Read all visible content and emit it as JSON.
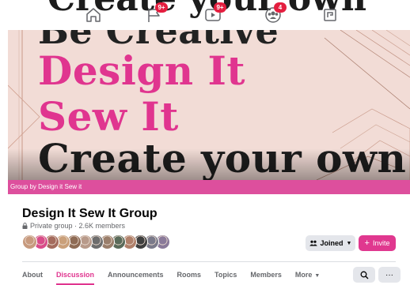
{
  "topnav": {
    "icons": [
      {
        "name": "home-icon",
        "badge": ""
      },
      {
        "name": "flag-icon",
        "badge": "9+"
      },
      {
        "name": "video-icon",
        "badge": "9+"
      },
      {
        "name": "groups-icon",
        "badge": "4"
      },
      {
        "name": "gaming-icon",
        "badge": ""
      }
    ]
  },
  "cover": {
    "lines": [
      "Be Creative",
      "Design It",
      "Sew It",
      "Create your own"
    ],
    "accent_color": "#e0358f",
    "background_color": "#f2dcd6",
    "strip_label": "Group by Design it Sew it",
    "strip_color": "#dd4f9d"
  },
  "group": {
    "name": "Design It Sew It Group",
    "meta": "Private group · 2.6K members",
    "avatar_colors": [
      "#c79a7e",
      "#d94c8a",
      "#a46b5d",
      "#caa07a",
      "#8e6b55",
      "#b89a8a",
      "#6d6d6d",
      "#9a7e6b",
      "#5a6b5a",
      "#b0806a",
      "#3f3f3f",
      "#7a7a8a",
      "#8a7a9a"
    ]
  },
  "buttons": {
    "joined": "Joined",
    "invite": "Invite"
  },
  "tabs": [
    {
      "label": "About",
      "active": false
    },
    {
      "label": "Discussion",
      "active": true
    },
    {
      "label": "Announcements",
      "active": false
    },
    {
      "label": "Rooms",
      "active": false
    },
    {
      "label": "Topics",
      "active": false
    },
    {
      "label": "Members",
      "active": false
    },
    {
      "label": "More",
      "active": false
    }
  ],
  "actions": {
    "more_glyph": "···"
  }
}
